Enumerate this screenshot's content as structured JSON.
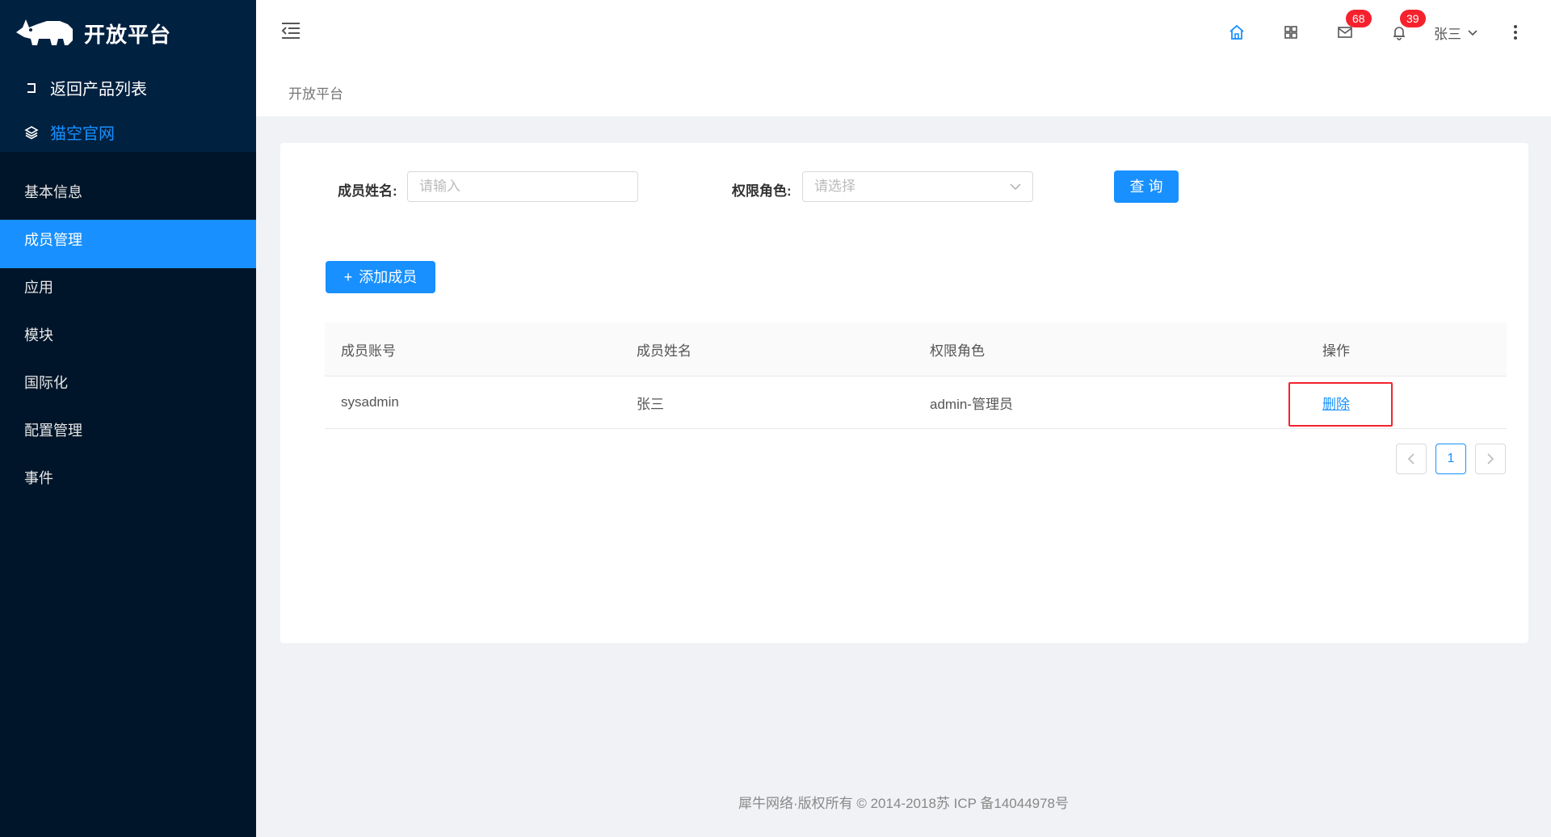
{
  "sidebar": {
    "brand": "开放平台",
    "back_link": "返回产品列表",
    "site_link": "猫空官网",
    "items": [
      {
        "label": "基本信息"
      },
      {
        "label": "成员管理"
      },
      {
        "label": "应用"
      },
      {
        "label": "模块"
      },
      {
        "label": "国际化"
      },
      {
        "label": "配置管理"
      },
      {
        "label": "事件"
      }
    ],
    "active_index": 1
  },
  "header": {
    "icons": [
      "home-icon",
      "apps-grid-icon",
      "mail-icon",
      "bell-icon"
    ],
    "mail_badge": "68",
    "notification_badge": "39",
    "user_name": "张三",
    "accent_color": "#1890ff",
    "badge_color": "#f5222d"
  },
  "breadcrumb": "开放平台",
  "search_form": {
    "name_label": "成员姓名",
    "name_placeholder": "请输入",
    "role_label": "权限角色",
    "role_placeholder": "请选择",
    "query_button": "查 询"
  },
  "add_button": "添加成员",
  "table": {
    "headers": [
      "成员账号",
      "成员姓名",
      "权限角色",
      "操作"
    ],
    "rows": [
      {
        "account": "sysadmin",
        "name": "张三",
        "role": "admin-管理员",
        "action": "删除"
      }
    ]
  },
  "pagination": {
    "current_page": "1"
  },
  "footer": "犀牛网络·版权所有 © 2014-2018苏 ICP 备14044978号"
}
